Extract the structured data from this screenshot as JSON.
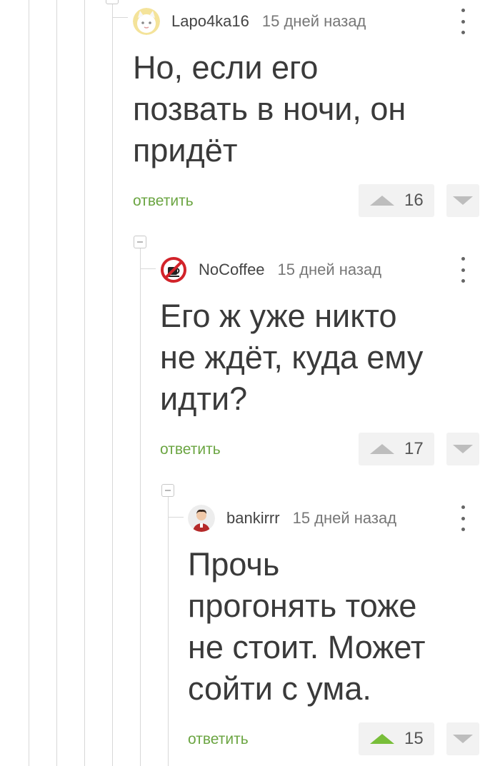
{
  "colors": {
    "reply": "#6ba542",
    "upvoted": "#78be39",
    "thread_line": "#d8d8d8"
  },
  "comments": [
    {
      "username": "Lapo4ka16",
      "time": "15 дней назад",
      "avatar_icon": "cat-avatar-icon",
      "lines": [
        "Но, если его",
        "позвать в ночи, он",
        "придёт"
      ],
      "reply_label": "ответить",
      "rating": "16",
      "upvoted": false
    },
    {
      "username": "NoCoffee",
      "time": "15 дней назад",
      "avatar_icon": "no-coffee-avatar-icon",
      "lines": [
        "Его ж уже никто",
        "не ждёт, куда ему",
        "идти?"
      ],
      "reply_label": "ответить",
      "rating": "17",
      "upvoted": false
    },
    {
      "username": "bankirrr",
      "time": "15 дней назад",
      "avatar_icon": "man-avatar-icon",
      "lines": [
        "Прочь",
        "прогонять тоже",
        "не стоит. Может",
        "сойти с ума."
      ],
      "reply_label": "ответить",
      "rating": "15",
      "upvoted": true
    }
  ]
}
